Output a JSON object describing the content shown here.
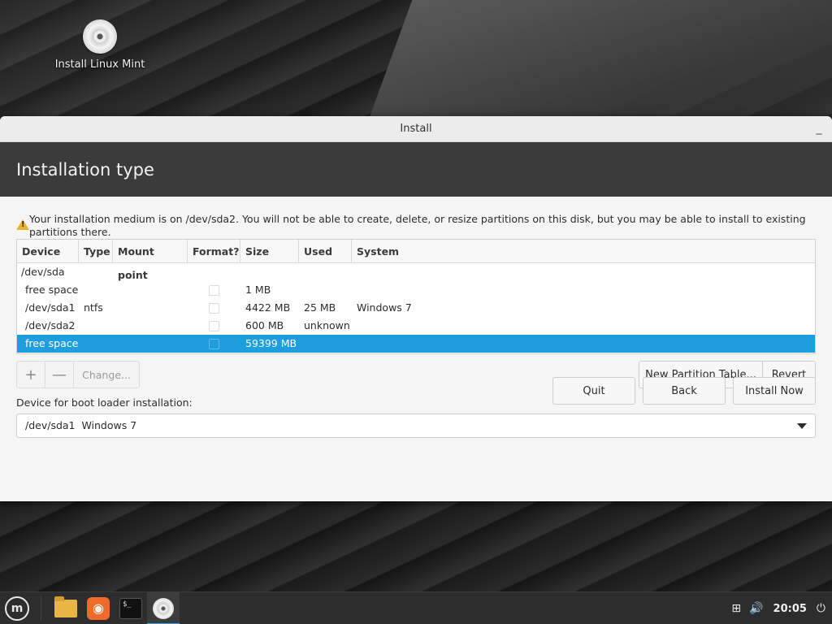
{
  "desktop": {
    "icon_label": "Install Linux Mint"
  },
  "window": {
    "title": "Install",
    "header_title": "Installation type",
    "warning_text": "Your installation medium is on /dev/sda2. You will not be able to create, delete, or resize partitions on this disk, but you may be able to install to existing partitions there.",
    "table": {
      "columns": [
        "Device",
        "Type",
        "Mount point",
        "Format?",
        "Size",
        "Used",
        "System"
      ],
      "disk": "/dev/sda",
      "rows": [
        {
          "device": "free space",
          "type": "",
          "mount": "",
          "size": "1 MB",
          "used": "",
          "system": ""
        },
        {
          "device": "/dev/sda1",
          "type": "ntfs",
          "mount": "",
          "size": "4422 MB",
          "used": "25 MB",
          "system": "Windows 7"
        },
        {
          "device": "/dev/sda2",
          "type": "",
          "mount": "",
          "size": "600 MB",
          "used": "unknown",
          "system": ""
        },
        {
          "device": "free space",
          "type": "",
          "mount": "",
          "size": "59399 MB",
          "used": "",
          "system": ""
        }
      ],
      "selected_row_index": 3
    },
    "toolbar": {
      "add_label": "+",
      "remove_label": "—",
      "change_label": "Change...",
      "new_partition_table_label": "New Partition Table...",
      "revert_label": "Revert"
    },
    "boot_loader": {
      "label": "Device for boot loader installation:",
      "selected": "/dev/sda1  Windows 7"
    },
    "buttons": {
      "quit": "Quit",
      "back": "Back",
      "install_now": "Install Now"
    }
  },
  "taskbar": {
    "clock": "20:05"
  }
}
